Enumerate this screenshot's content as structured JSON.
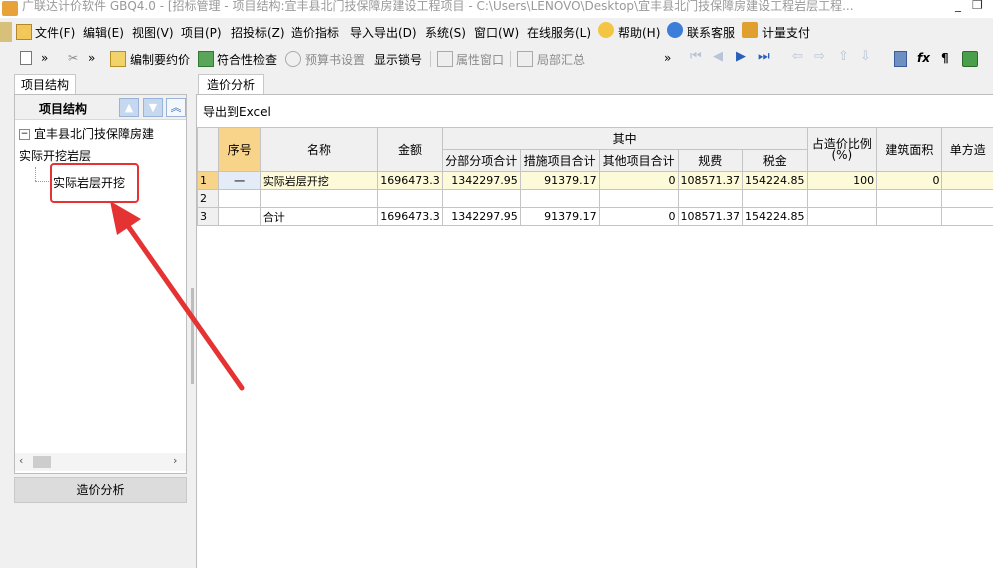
{
  "window": {
    "title": "广联达计价软件 GBQ4.0 - [招标管理 - 项目结构:宜丰县北门技保障房建设工程项目 - C:\\Users\\LENOVO\\Desktop\\宜丰县北门技保障房建设工程岩层工程...",
    "minimize": "_",
    "restore": "❐"
  },
  "menu": {
    "items": [
      "文件(F)",
      "编辑(E)",
      "视图(V)",
      "项目(P)",
      "招投标(Z)",
      "造价指标",
      "导入导出(D)",
      "系统(S)",
      "窗口(W)",
      "在线服务(L)",
      "帮助(H)",
      "联系客服",
      "计量支付"
    ]
  },
  "toolbar": {
    "overflow": "»",
    "cut_overflow": "»",
    "edit_contract_price": "编制要约价",
    "compliance_check": "符合性检查",
    "budget_settings": "预算书设置",
    "show_lock": "显示锁号",
    "property_window": "属性窗口",
    "partial_summary": "局部汇总",
    "nav_overflow": "»",
    "fx": "fx",
    "para": "¶"
  },
  "left_panel": {
    "tab": "项目结构",
    "header": "项目结构",
    "tree": {
      "root": "宜丰县北门技保障房建",
      "level1": "实际开挖岩层",
      "level2": "实际岩层开挖"
    },
    "bottom_button": "造价分析"
  },
  "right_panel": {
    "tab": "造价分析",
    "export_button": "导出到Excel",
    "table": {
      "headers": {
        "seq": "序号",
        "name": "名称",
        "amount": "金额",
        "of_which": "其中",
        "sub_items": "分部分项合计",
        "measures": "措施项目合计",
        "others": "其他项目合计",
        "fees": "规费",
        "tax": "税金",
        "ratio": "占造价比例(%)",
        "area": "建筑面积",
        "unit_cost": "单方造"
      },
      "rows": [
        {
          "row": "1",
          "seq": "一",
          "name": "实际岩层开挖",
          "amount": "1696473.3",
          "sub_items": "1342297.95",
          "measures": "91379.17",
          "others": "0",
          "fees": "108571.37",
          "tax": "154224.85",
          "ratio": "100",
          "area": "0",
          "unit_cost": ""
        },
        {
          "row": "2",
          "seq": "",
          "name": "",
          "amount": "",
          "sub_items": "",
          "measures": "",
          "others": "",
          "fees": "",
          "tax": "",
          "ratio": "",
          "area": "",
          "unit_cost": ""
        },
        {
          "row": "3",
          "seq": "",
          "name": "合计",
          "amount": "1696473.3",
          "sub_items": "1342297.95",
          "measures": "91379.17",
          "others": "0",
          "fees": "108571.37",
          "tax": "154224.85",
          "ratio": "",
          "area": "",
          "unit_cost": ""
        }
      ]
    }
  },
  "colors": {
    "highlight_red": "#e53232",
    "seq_header": "#f7d48a",
    "selected_row": "#fdfad9"
  }
}
